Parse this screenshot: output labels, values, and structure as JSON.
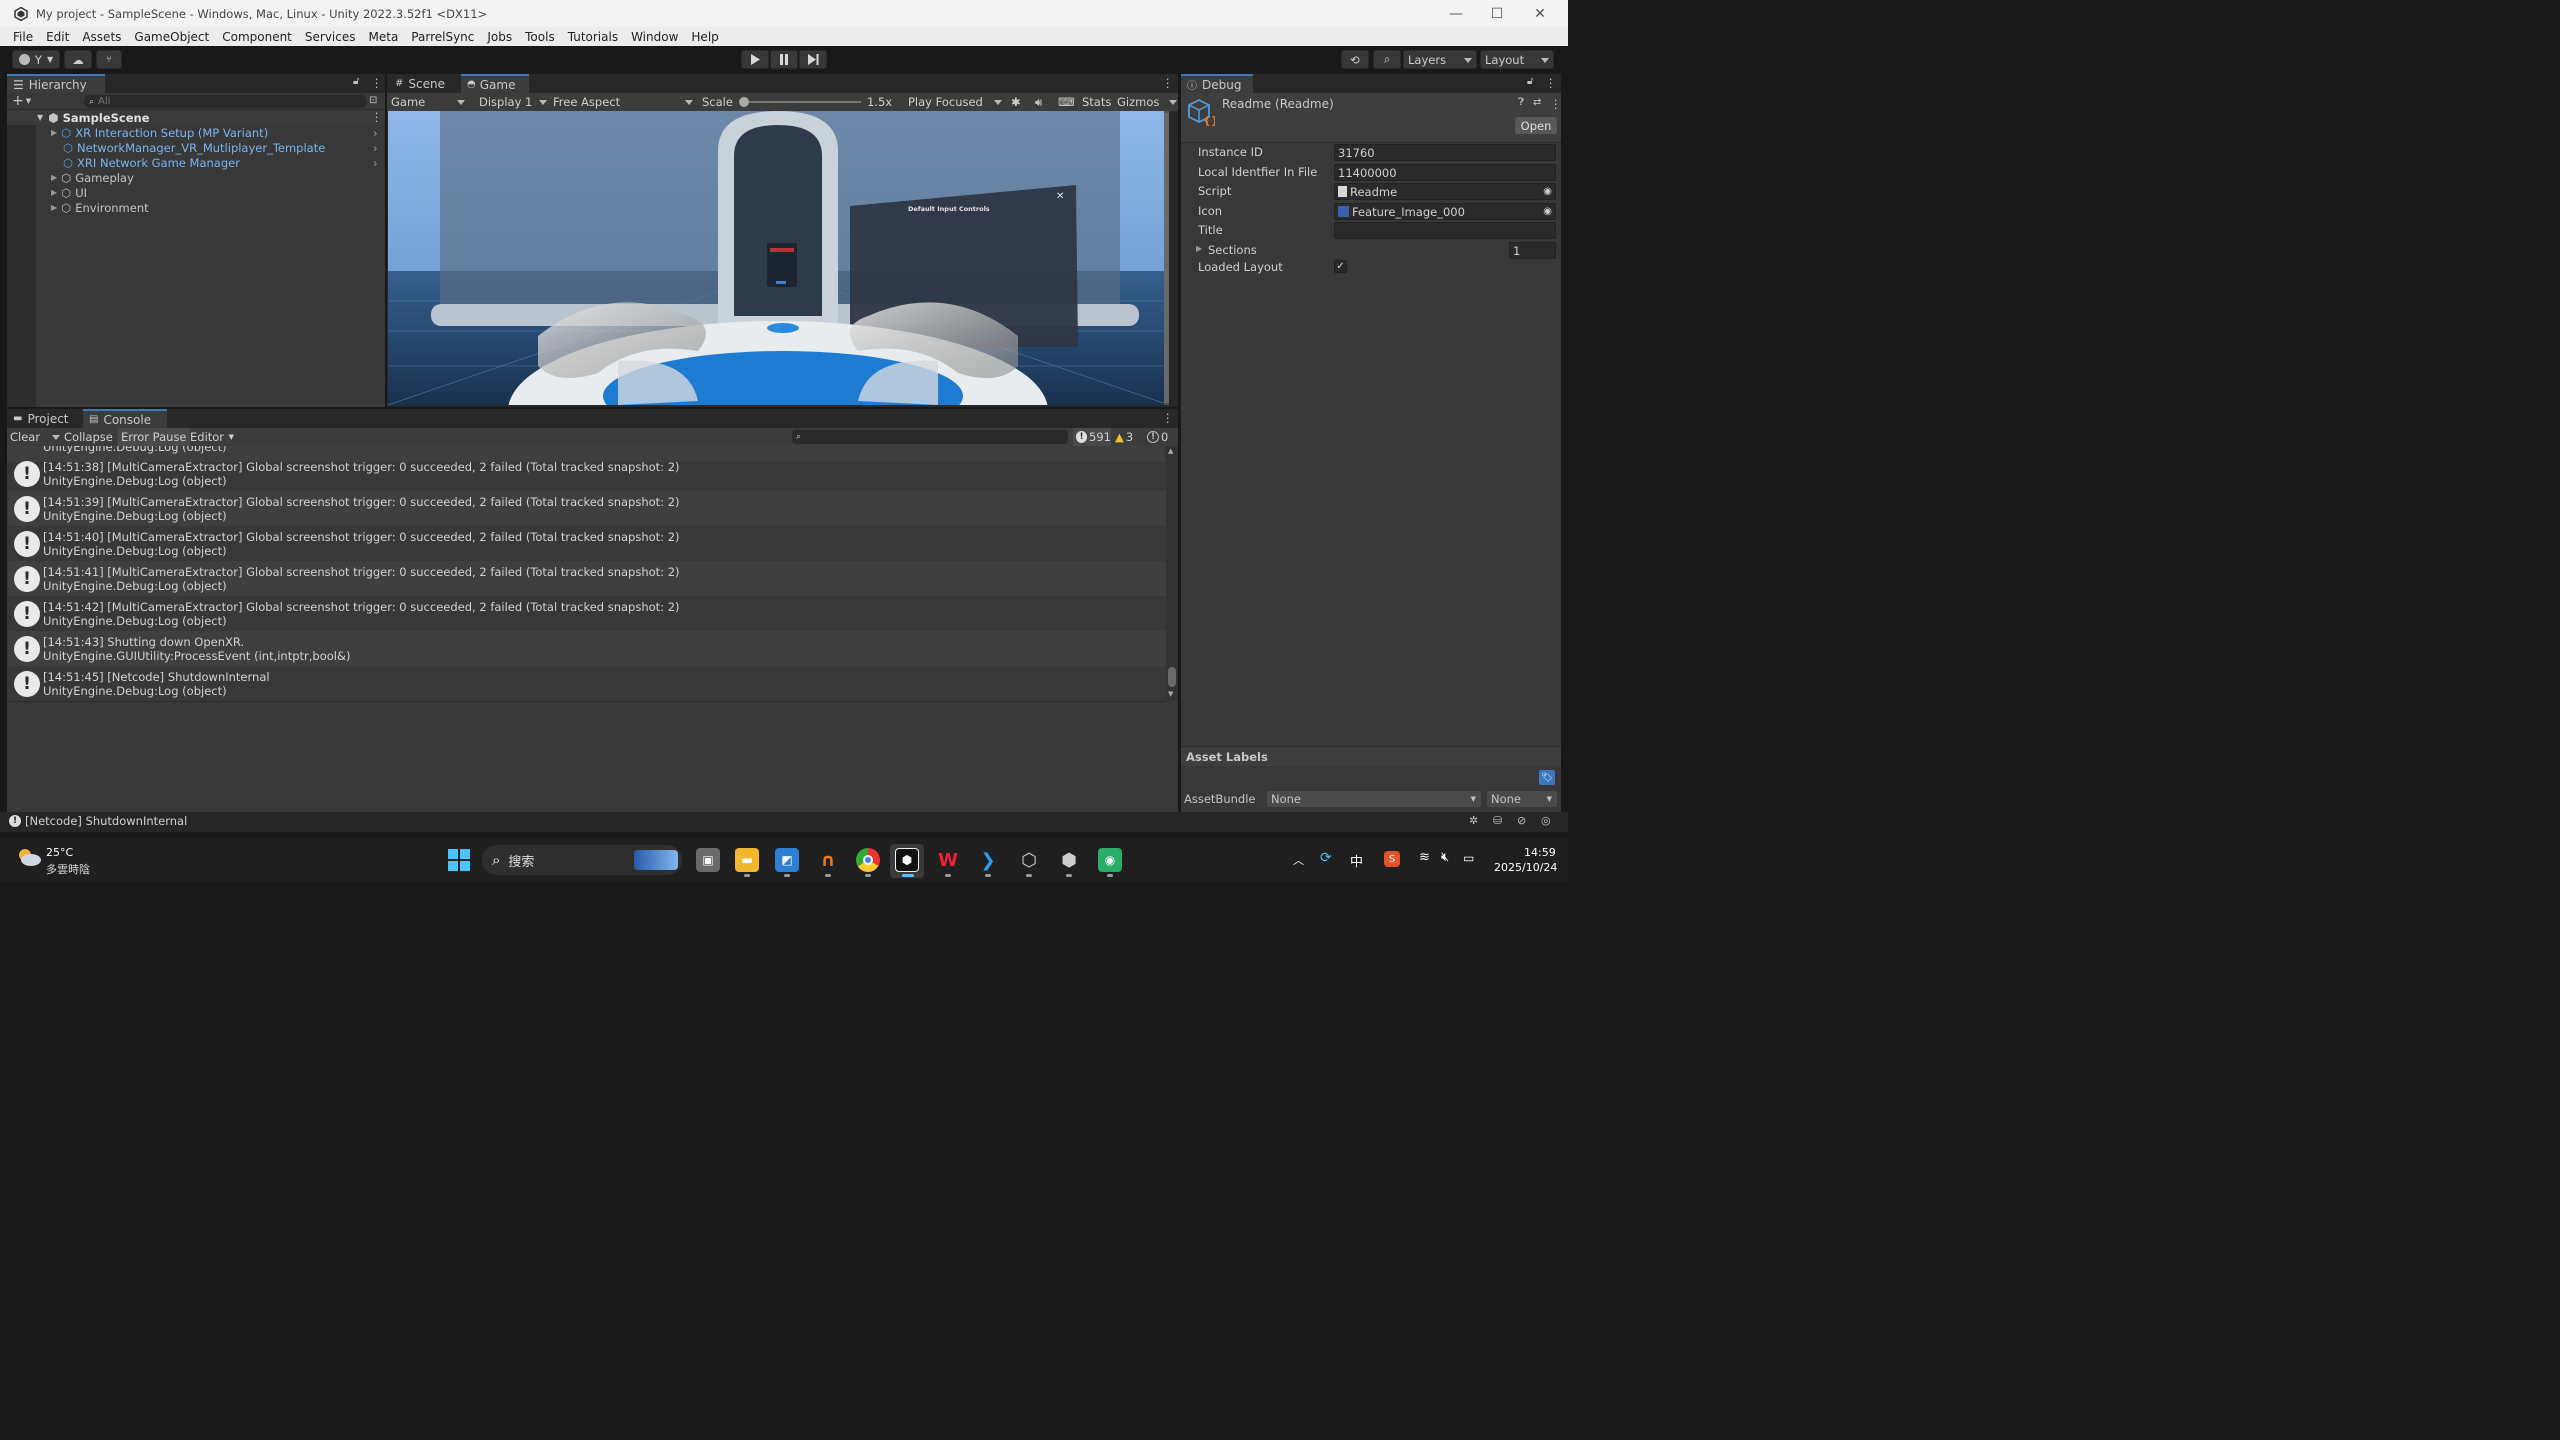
{
  "window": {
    "title": "My project - SampleScene - Windows, Mac, Linux - Unity 2022.3.52f1 <DX11>",
    "controls": {
      "minimize": "—",
      "maximize": "☐",
      "close": "✕"
    }
  },
  "menu": [
    "File",
    "Edit",
    "Assets",
    "GameObject",
    "Component",
    "Services",
    "Meta",
    "ParrelSync",
    "Jobs",
    "Tools",
    "Tutorials",
    "Window",
    "Help"
  ],
  "toolbar": {
    "account": "Y",
    "layers": "Layers",
    "layout": "Layout"
  },
  "hierarchy": {
    "tab": "Hierarchy",
    "search_placeholder": "All",
    "scene": "SampleScene",
    "items": [
      {
        "label": "XR Interaction Setup (MP Variant)",
        "prefab": true
      },
      {
        "label": "NetworkManager_VR_Mutliplayer_Template",
        "prefab": true
      },
      {
        "label": "XRI Network Game Manager",
        "prefab": true
      },
      {
        "label": "Gameplay",
        "prefab": false
      },
      {
        "label": "UI",
        "prefab": false
      },
      {
        "label": "Environment",
        "prefab": false
      }
    ]
  },
  "game": {
    "tabs": {
      "scene": "Scene",
      "game": "Game"
    },
    "view_mode": "Game",
    "display": "Display 1",
    "aspect": "Free Aspect",
    "scale_label": "Scale",
    "scale_value": "1.5x",
    "play_mode": "Play Focused",
    "stats": "Stats",
    "gizmos": "Gizmos",
    "scene_panel_title": "Default Input Controls"
  },
  "console": {
    "tabs": {
      "project": "Project",
      "console": "Console"
    },
    "clear": "Clear",
    "collapse": "Collapse",
    "error_pause": "Error Pause",
    "editor": "Editor",
    "counts": {
      "log": "591",
      "warn": "3",
      "error": "0"
    },
    "clipped_top": "UnityEngine.Debug:Log (object)",
    "entries": [
      {
        "line1": "[14:51:38] [MultiCameraExtractor] Global screenshot trigger: 0 succeeded, 2 failed (Total tracked snapshot: 2)",
        "line2": "UnityEngine.Debug:Log (object)"
      },
      {
        "line1": "[14:51:39] [MultiCameraExtractor] Global screenshot trigger: 0 succeeded, 2 failed (Total tracked snapshot: 2)",
        "line2": "UnityEngine.Debug:Log (object)"
      },
      {
        "line1": "[14:51:40] [MultiCameraExtractor] Global screenshot trigger: 0 succeeded, 2 failed (Total tracked snapshot: 2)",
        "line2": "UnityEngine.Debug:Log (object)"
      },
      {
        "line1": "[14:51:41] [MultiCameraExtractor] Global screenshot trigger: 0 succeeded, 2 failed (Total tracked snapshot: 2)",
        "line2": "UnityEngine.Debug:Log (object)"
      },
      {
        "line1": "[14:51:42] [MultiCameraExtractor] Global screenshot trigger: 0 succeeded, 2 failed (Total tracked snapshot: 2)",
        "line2": "UnityEngine.Debug:Log (object)"
      },
      {
        "line1": "[14:51:43] Shutting down OpenXR.",
        "line2": "UnityEngine.GUIUtility:ProcessEvent (int,intptr,bool&)"
      },
      {
        "line1": "[14:51:45] [Netcode] ShutdownInternal",
        "line2": "UnityEngine.Debug:Log (object)"
      }
    ]
  },
  "inspector": {
    "tab": "Debug",
    "object_name": "Readme (Readme)",
    "open": "Open",
    "fields": {
      "instance_id": {
        "label": "Instance ID",
        "value": "31760"
      },
      "local_id": {
        "label": "Local Identfier In File",
        "value": "11400000"
      },
      "script": {
        "label": "Script",
        "value": "Readme"
      },
      "icon": {
        "label": "Icon",
        "value": "Feature_Image_000"
      },
      "title": {
        "label": "Title",
        "value": ""
      },
      "sections": {
        "label": "Sections",
        "value": "1"
      },
      "loaded_layout": {
        "label": "Loaded Layout",
        "checked": true
      }
    },
    "asset_labels": "Asset Labels",
    "asset_bundle_label": "AssetBundle",
    "asset_bundle_value": "None",
    "asset_bundle_variant": "None"
  },
  "statusbar": {
    "message": "[Netcode] ShutdownInternal"
  },
  "taskbar": {
    "weather_temp": "25°C",
    "weather_desc": "多雲時陰",
    "search": "搜索",
    "ime": "中",
    "time": "14:59",
    "date": "2025/10/24"
  },
  "colors": {
    "accent_blue": "#3a79bb",
    "prefab_text": "#7cb4f0",
    "panel_bg": "#383838",
    "dark_bg": "#191919"
  }
}
